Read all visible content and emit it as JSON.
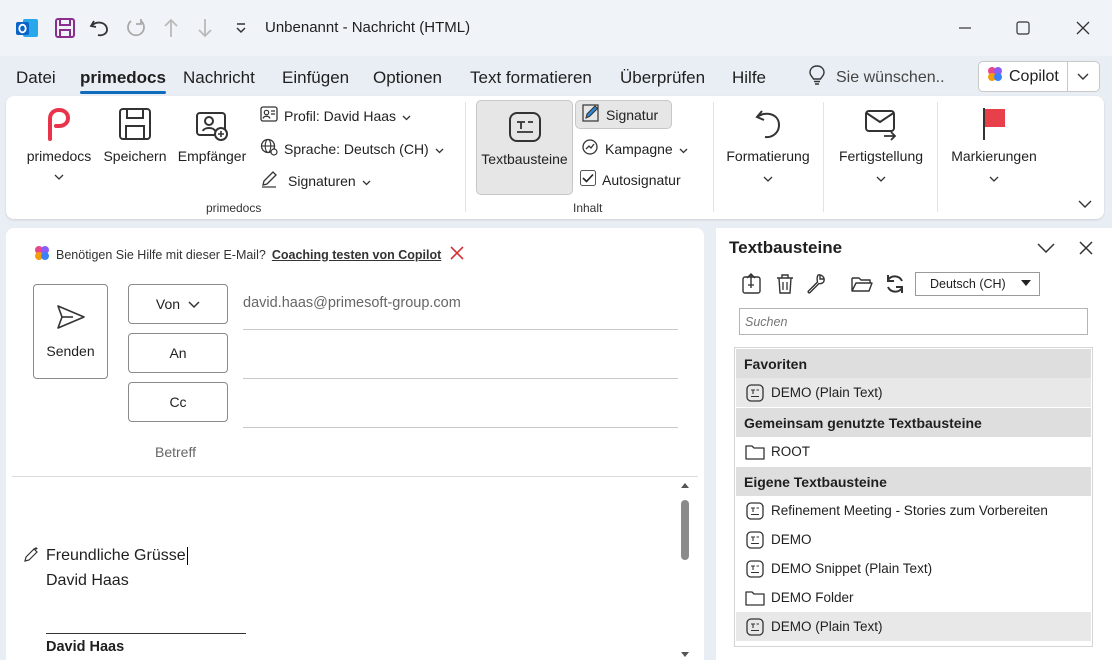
{
  "window": {
    "title": "Unbenannt  -  Nachricht (HTML)"
  },
  "menu": {
    "tabs": [
      {
        "label": "Datei"
      },
      {
        "label": "primedocs"
      },
      {
        "label": "Nachricht"
      },
      {
        "label": "Einfügen"
      },
      {
        "label": "Optionen"
      },
      {
        "label": "Text formatieren"
      },
      {
        "label": "Überprüfen"
      },
      {
        "label": "Hilfe"
      }
    ],
    "tellme_placeholder": "Sie wünschen..",
    "copilot_label": "Copilot"
  },
  "ribbon": {
    "primedocs_label": "primedocs",
    "save_label": "Speichern",
    "recipient_label": "Empfänger",
    "profile_label": "Profil: David Haas",
    "language_label": "Sprache: Deutsch (CH)",
    "signatures_label": "Signaturen",
    "group_primedocs": "primedocs",
    "textbausteine_label": "Textbausteine",
    "signatur_label": "Signatur",
    "kampagne_label": "Kampagne",
    "autosignatur_label": "Autosignatur",
    "group_inhalt": "Inhalt",
    "formatierung_label": "Formatierung",
    "fertigstellung_label": "Fertigstellung",
    "markierungen_label": "Markierungen"
  },
  "compose": {
    "copilot_hint": "Benötigen Sie Hilfe mit dieser E-Mail?",
    "copilot_link": "Coaching testen von Copilot",
    "send_label": "Senden",
    "from_label": "Von",
    "to_label": "An",
    "cc_label": "Cc",
    "from_value": "david.haas@primesoft-group.com",
    "subject_placeholder": "Betreff",
    "body_line1": "Freundliche Grüsse",
    "body_line2": "David Haas",
    "sig_name": "David Haas"
  },
  "pane": {
    "title": "Textbausteine",
    "language_value": "Deutsch (CH)",
    "search_placeholder": "Suchen",
    "sections": {
      "favorites": {
        "label": "Favoriten",
        "items": [
          {
            "label": "DEMO (Plain Text)",
            "icon": "snippet-icon"
          }
        ]
      },
      "shared": {
        "label": "Gemeinsam genutzte Textbausteine",
        "items": [
          {
            "label": "ROOT",
            "icon": "folder-icon"
          }
        ]
      },
      "own": {
        "label": "Eigene Textbausteine",
        "items": [
          {
            "label": "Refinement Meeting - Stories zum Vorbereiten",
            "icon": "snippet-icon"
          },
          {
            "label": "DEMO",
            "icon": "snippet-icon"
          },
          {
            "label": "DEMO Snippet (Plain Text)",
            "icon": "snippet-icon"
          },
          {
            "label": "DEMO Folder",
            "icon": "folder-icon"
          },
          {
            "label": "DEMO (Plain Text)",
            "icon": "snippet-icon"
          }
        ]
      }
    }
  },
  "colors": {
    "accent": "#0f6cbd",
    "primedocs_brand": "#e8334a",
    "outlook_blue": "#0a64c8",
    "save_purple": "#8a2f8f",
    "flag_red": "#e8404a",
    "close_red": "#d13438"
  }
}
